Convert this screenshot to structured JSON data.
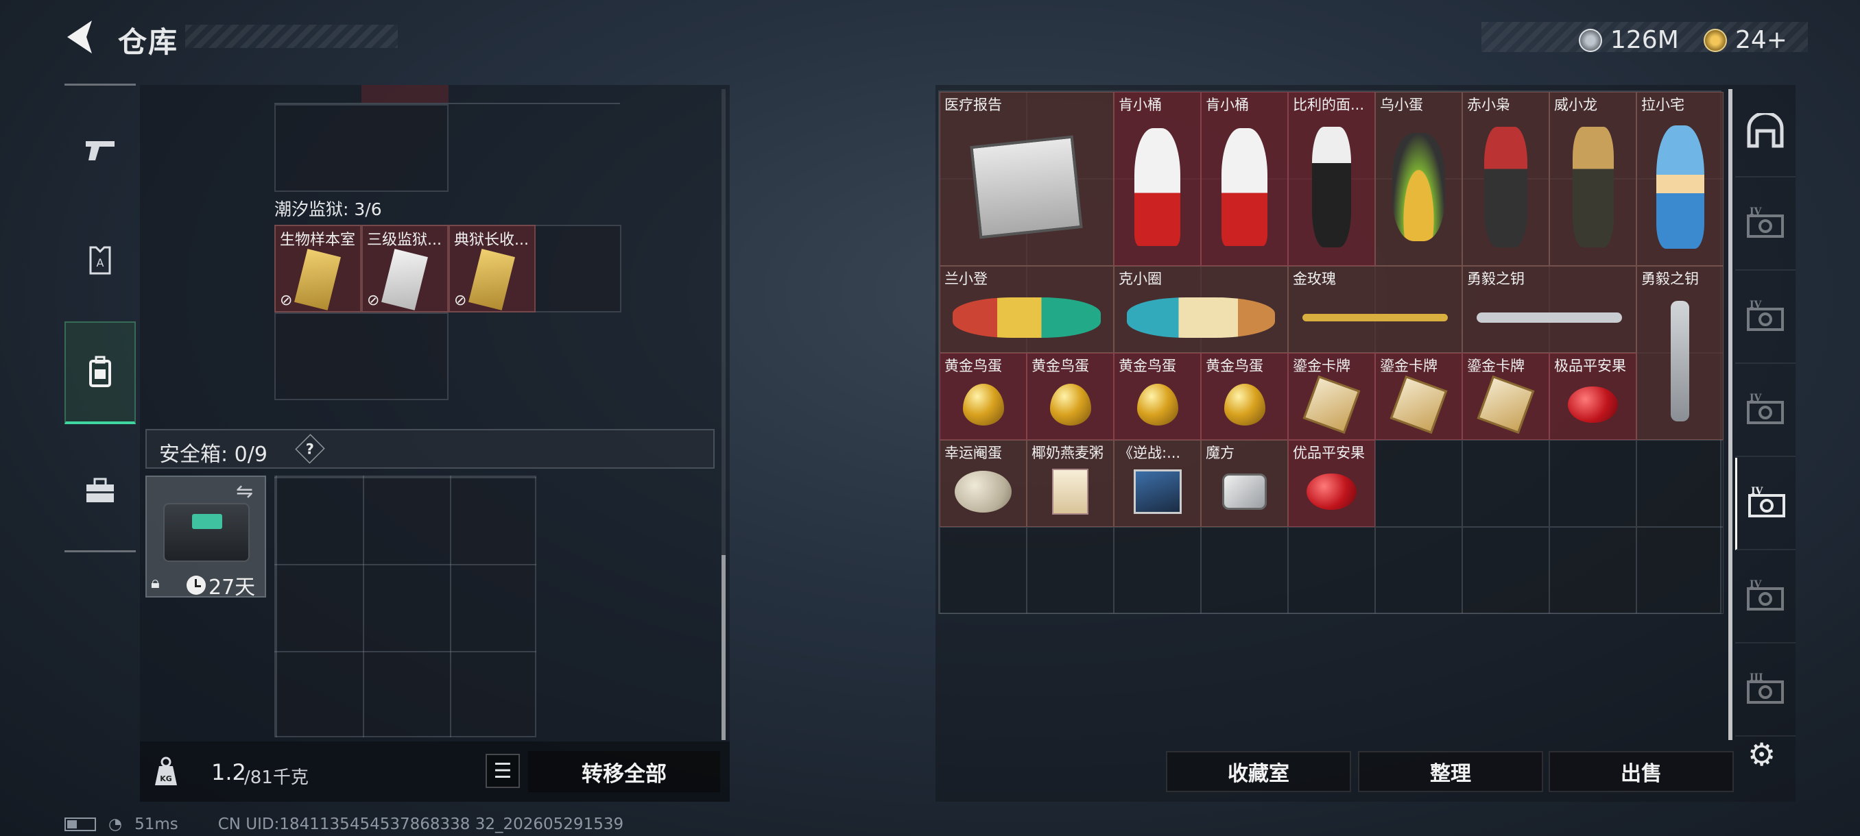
{
  "header": {
    "title": "仓库"
  },
  "currency": [
    {
      "icon": "coin-icon",
      "value": "126M"
    },
    {
      "icon": "triangle-coin-icon",
      "value": "24+"
    }
  ],
  "left_nav": [
    {
      "icon": "gun-icon"
    },
    {
      "icon": "armor-vest-icon"
    },
    {
      "icon": "backpack-icon",
      "active": true
    },
    {
      "icon": "toolbox-icon"
    }
  ],
  "left_panel": {
    "section_title": "潮汐监狱: 3/6",
    "keycards": [
      {
        "name": "生物样本室"
      },
      {
        "name": "三级监狱..."
      },
      {
        "name": "典狱长收..."
      }
    ],
    "safe_box": {
      "label": "安全箱: 0/9",
      "help": "?",
      "duration": "27天"
    },
    "weight": {
      "current": "1.2",
      "max": "/81千克"
    },
    "transfer_all": "转移全部"
  },
  "right_grid": {
    "items": [
      {
        "name": "医疗报告",
        "thumb": "report"
      },
      {
        "name": "肯小桶",
        "thumb": "kfc"
      },
      {
        "name": "肯小桶",
        "thumb": "kfc"
      },
      {
        "name": "比利的面...",
        "thumb": "puppet"
      },
      {
        "name": "乌小蛋",
        "thumb": "egg-doll"
      },
      {
        "name": "赤小枭",
        "thumb": "red-doll"
      },
      {
        "name": "威小龙",
        "thumb": "soldier"
      },
      {
        "name": "拉小宅",
        "thumb": "blue-doll"
      },
      {
        "name": "兰小登",
        "thumb": "clown"
      },
      {
        "name": "克小圈",
        "thumb": "ring-doll"
      },
      {
        "name": "金玫瑰",
        "thumb": "rose"
      },
      {
        "name": "勇毅之钥",
        "thumb": "key"
      },
      {
        "name": "勇毅之钥",
        "thumb": "key-vertical"
      },
      {
        "name": "黄金鸟蛋",
        "thumb": "golden-egg"
      },
      {
        "name": "黄金鸟蛋",
        "thumb": "golden-egg"
      },
      {
        "name": "黄金鸟蛋",
        "thumb": "golden-egg"
      },
      {
        "name": "黄金鸟蛋",
        "thumb": "golden-egg"
      },
      {
        "name": "鎏金卡牌",
        "thumb": "card"
      },
      {
        "name": "鎏金卡牌",
        "thumb": "card"
      },
      {
        "name": "鎏金卡牌",
        "thumb": "card"
      },
      {
        "name": "极品平安果",
        "thumb": "apple"
      },
      {
        "name": "幸运阉蛋",
        "thumb": "spotted-egg"
      },
      {
        "name": "椰奶燕麦粥",
        "thumb": "cereal"
      },
      {
        "name": "《逆战:...",
        "thumb": "game-box"
      },
      {
        "name": "魔方",
        "thumb": "cube"
      },
      {
        "name": "优品平安果",
        "thumb": "apple"
      }
    ]
  },
  "right_sidebar": [
    {
      "icon": "shelter-icon"
    },
    {
      "icon": "card-tier-4-icon",
      "label": "IV"
    },
    {
      "icon": "card-tier-4-icon",
      "label": "IV"
    },
    {
      "icon": "card-tier-4-icon",
      "label": "IV"
    },
    {
      "icon": "card-tier-4-icon",
      "label": "IV",
      "active": true
    },
    {
      "icon": "card-tier-4-icon",
      "label": "IV"
    },
    {
      "icon": "card-tier-3-icon",
      "label": "III"
    }
  ],
  "bottom_buttons": {
    "collection": "收藏室",
    "sort": "整理",
    "sell": "出售"
  },
  "status": {
    "ping": "51ms",
    "uid": "CN UID:1841135454537868338 32_202605291539"
  }
}
